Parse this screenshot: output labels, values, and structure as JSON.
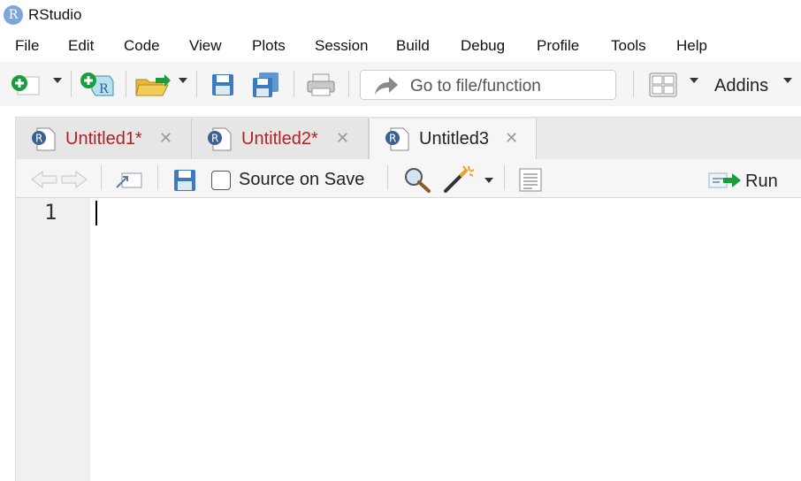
{
  "window": {
    "title": "RStudio",
    "logo_letter": "R"
  },
  "menu": [
    "File",
    "Edit",
    "Code",
    "View",
    "Plots",
    "Session",
    "Build",
    "Debug",
    "Profile",
    "Tools",
    "Help"
  ],
  "toolbar": {
    "goto_placeholder": "Go to file/function",
    "addins_label": "Addins"
  },
  "tabs": [
    {
      "label": "Untitled1*",
      "modified": true,
      "active": false
    },
    {
      "label": "Untitled2*",
      "modified": true,
      "active": false
    },
    {
      "label": "Untitled3",
      "modified": false,
      "active": true
    }
  ],
  "editor_toolbar": {
    "source_on_save_label": "Source on Save",
    "source_on_save_checked": false,
    "run_label": "Run"
  },
  "editor": {
    "line_numbers": [
      "1"
    ],
    "content": ""
  },
  "colors": {
    "modified_tab_text": "#b22222",
    "run_arrow": "#1a9e3c",
    "new_file_plus": "#1a9e3c",
    "save_blue": "#3b7bbf"
  }
}
